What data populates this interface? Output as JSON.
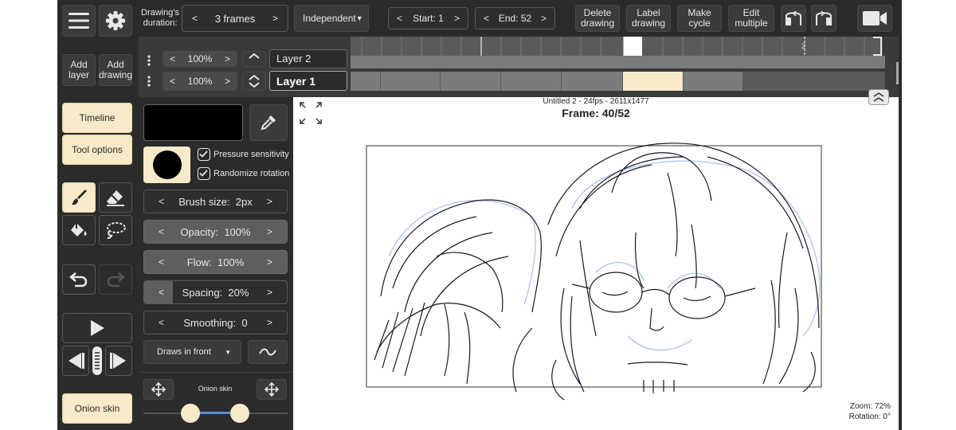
{
  "toolbar": {
    "duration_label": "Drawing's duration:",
    "duration_value": "3 frames",
    "timing_mode": "Independent",
    "start": "Start: 1",
    "end": "End: 52",
    "delete_drawing": "Delete drawing",
    "label_drawing": "Label drawing",
    "make_cycle": "Make cycle",
    "edit_multiple": "Edit multiple"
  },
  "sidebar": {
    "add_layer": "Add layer",
    "add_drawing": "Add drawing",
    "timeline": "Timeline",
    "tool_options": "Tool options",
    "onion_skin": "Onion skin"
  },
  "layers": [
    {
      "opacity": "100%",
      "name": "Layer 2"
    },
    {
      "opacity": "100%",
      "name": "Layer 1"
    }
  ],
  "timeline": {
    "ruler_mark": "2"
  },
  "tool_options": {
    "pressure": "Pressure sensitivity",
    "randomize": "Randomize rotation",
    "brush_size": "Brush size:  2px",
    "opacity": "Opacity:  100%",
    "flow": "Flow:  100%",
    "spacing": "Spacing:  20%",
    "smoothing": "Smoothing:  0",
    "draw_mode": "Draws in front",
    "onion_label": "Onion skin",
    "color": "#000000"
  },
  "canvas": {
    "doc_info": "Untitled 2 - 24fps - 2611x1477",
    "frame": "Frame: 40/52",
    "zoom": "Zoom: 72%",
    "rotation": "Rotation: 0°"
  }
}
